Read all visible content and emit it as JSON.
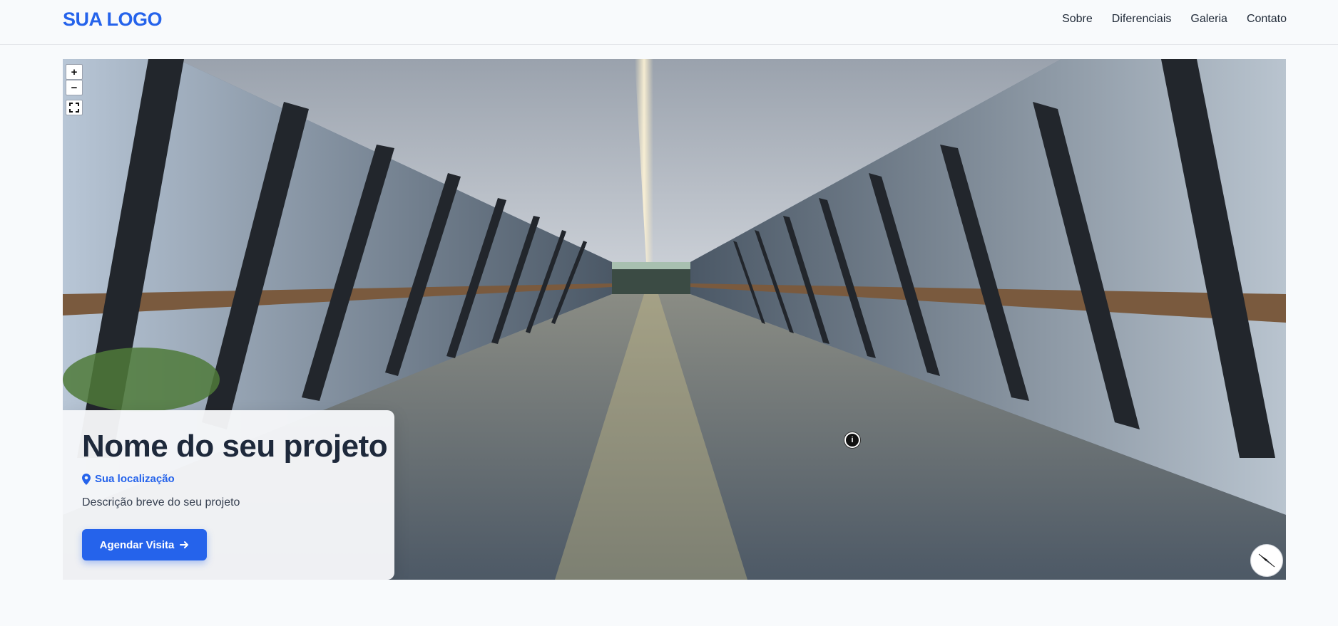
{
  "header": {
    "logo": "SUA LOGO",
    "nav": [
      "Sobre",
      "Diferenciais",
      "Galeria",
      "Contato"
    ]
  },
  "viewer": {
    "zoom_in": "+",
    "zoom_out": "−",
    "hotspot": "i"
  },
  "card": {
    "title": "Nome do seu projeto",
    "location": "Sua localização",
    "description": "Descrição breve do seu projeto",
    "cta_label": "Agendar Visita"
  },
  "colors": {
    "accent": "#2563eb",
    "background": "#f8fafc",
    "heading": "#1e293b"
  },
  "icons": [
    "plus-icon",
    "minus-icon",
    "fullscreen-icon",
    "info-icon",
    "compass-icon",
    "map-pin-icon",
    "arrow-right-icon"
  ]
}
